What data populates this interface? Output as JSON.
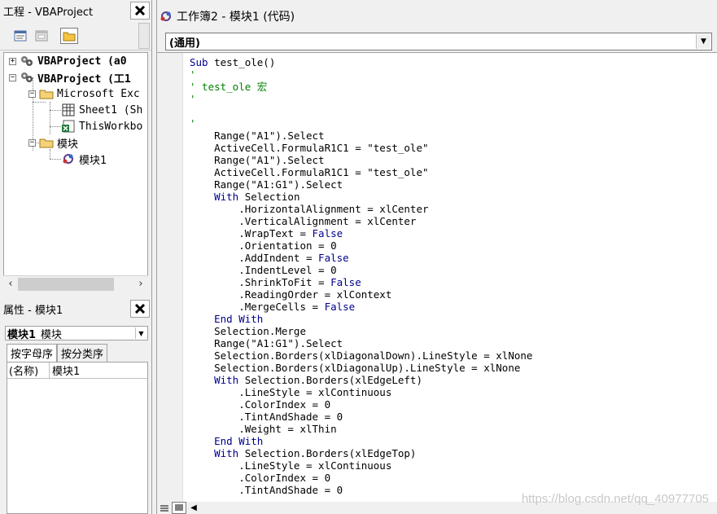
{
  "project_panel": {
    "title": "工程 - VBAProject",
    "tree": [
      {
        "label": "VBAProject (a0",
        "bold": true,
        "expander": "+"
      },
      {
        "label": "VBAProject (工1",
        "bold": true,
        "expander": "-"
      },
      {
        "label": "Microsoft Exc",
        "bold": false,
        "expander": "-"
      },
      {
        "label": "Sheet1 (Sh",
        "bold": false
      },
      {
        "label": "ThisWorkbo",
        "bold": false
      },
      {
        "label": "模块",
        "bold": false,
        "expander": "-"
      },
      {
        "label": "模块1",
        "bold": false
      }
    ]
  },
  "props_panel": {
    "title": "属性 - 模块1",
    "combo_name": "模块1",
    "combo_type": "模块",
    "tabs": [
      "按字母序",
      "按分类序"
    ],
    "rows": [
      {
        "name": "(名称)",
        "value": "模块1"
      }
    ]
  },
  "code_window": {
    "title": "工作簿2 - 模块1 (代码)",
    "object_combo": "(通用)",
    "lines": [
      [
        {
          "t": "Sub",
          "c": "kw"
        },
        {
          "t": " test_ole()",
          "c": ""
        }
      ],
      [
        {
          "t": "'",
          "c": "cm"
        }
      ],
      [
        {
          "t": "' test_ole 宏",
          "c": "cm"
        }
      ],
      [
        {
          "t": "'",
          "c": "cm"
        }
      ],
      [
        {
          "t": "",
          "c": ""
        }
      ],
      [
        {
          "t": "'",
          "c": "cm"
        }
      ],
      [
        {
          "t": "    Range(\"A1\").Select",
          "c": ""
        }
      ],
      [
        {
          "t": "    ActiveCell.FormulaR1C1 = \"test_ole\"",
          "c": ""
        }
      ],
      [
        {
          "t": "    Range(\"A1\").Select",
          "c": ""
        }
      ],
      [
        {
          "t": "    ActiveCell.FormulaR1C1 = \"test_ole\"",
          "c": ""
        }
      ],
      [
        {
          "t": "    Range(\"A1:G1\").Select",
          "c": ""
        }
      ],
      [
        {
          "t": "    ",
          "c": ""
        },
        {
          "t": "With",
          "c": "kw"
        },
        {
          "t": " Selection",
          "c": ""
        }
      ],
      [
        {
          "t": "        .HorizontalAlignment = xlCenter",
          "c": ""
        }
      ],
      [
        {
          "t": "        .VerticalAlignment = xlCenter",
          "c": ""
        }
      ],
      [
        {
          "t": "        .WrapText = ",
          "c": ""
        },
        {
          "t": "False",
          "c": "kw"
        }
      ],
      [
        {
          "t": "        .Orientation = 0",
          "c": ""
        }
      ],
      [
        {
          "t": "        .AddIndent = ",
          "c": ""
        },
        {
          "t": "False",
          "c": "kw"
        }
      ],
      [
        {
          "t": "        .IndentLevel = 0",
          "c": ""
        }
      ],
      [
        {
          "t": "        .ShrinkToFit = ",
          "c": ""
        },
        {
          "t": "False",
          "c": "kw"
        }
      ],
      [
        {
          "t": "        .ReadingOrder = xlContext",
          "c": ""
        }
      ],
      [
        {
          "t": "        .MergeCells = ",
          "c": ""
        },
        {
          "t": "False",
          "c": "kw"
        }
      ],
      [
        {
          "t": "    ",
          "c": ""
        },
        {
          "t": "End With",
          "c": "kw"
        }
      ],
      [
        {
          "t": "    Selection.Merge",
          "c": ""
        }
      ],
      [
        {
          "t": "    Range(\"A1:G1\").Select",
          "c": ""
        }
      ],
      [
        {
          "t": "    Selection.Borders(xlDiagonalDown).LineStyle = xlNone",
          "c": ""
        }
      ],
      [
        {
          "t": "    Selection.Borders(xlDiagonalUp).LineStyle = xlNone",
          "c": ""
        }
      ],
      [
        {
          "t": "    ",
          "c": ""
        },
        {
          "t": "With",
          "c": "kw"
        },
        {
          "t": " Selection.Borders(xlEdgeLeft)",
          "c": ""
        }
      ],
      [
        {
          "t": "        .LineStyle = xlContinuous",
          "c": ""
        }
      ],
      [
        {
          "t": "        .ColorIndex = 0",
          "c": ""
        }
      ],
      [
        {
          "t": "        .TintAndShade = 0",
          "c": ""
        }
      ],
      [
        {
          "t": "        .Weight = xlThin",
          "c": ""
        }
      ],
      [
        {
          "t": "    ",
          "c": ""
        },
        {
          "t": "End With",
          "c": "kw"
        }
      ],
      [
        {
          "t": "    ",
          "c": ""
        },
        {
          "t": "With",
          "c": "kw"
        },
        {
          "t": " Selection.Borders(xlEdgeTop)",
          "c": ""
        }
      ],
      [
        {
          "t": "        .LineStyle = xlContinuous",
          "c": ""
        }
      ],
      [
        {
          "t": "        .ColorIndex = 0",
          "c": ""
        }
      ],
      [
        {
          "t": "        .TintAndShade = 0",
          "c": ""
        }
      ]
    ]
  },
  "watermark": "https://blog.csdn.net/qq_40977705",
  "colors": {
    "keyword": "#00008b",
    "comment": "#007f00"
  }
}
